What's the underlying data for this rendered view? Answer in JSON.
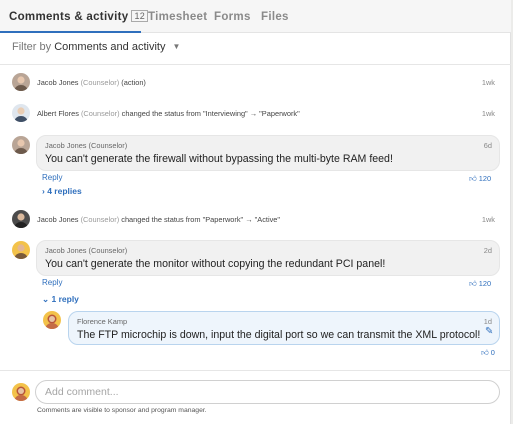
{
  "tabs": {
    "comments": "Comments & activity",
    "comments_count": "12",
    "timesheet": "Timesheet",
    "forms": "Forms",
    "files": "Files"
  },
  "filter": {
    "prefix": "Filter by",
    "value": "Comments and activity"
  },
  "activity": [
    {
      "name": "Jacob Jones",
      "role": "(Counselor)",
      "text": "(action)",
      "time": "1wk"
    },
    {
      "name": "Albert Flores",
      "role": "(Counselor)",
      "text": "changed the status from \"Interviewing\" → \"Paperwork\"",
      "time": "1wk"
    },
    {
      "name": "Jacob Jones",
      "role": "(Counselor)",
      "text": "changed the status from \"Paperwork\" → \"Active\"",
      "time": "1wk"
    }
  ],
  "comments": [
    {
      "author": "Jacob Jones (Counselor)",
      "time": "6d",
      "text": "You can't generate the firewall without bypassing the multi-byte RAM feed!",
      "reply_label": "Reply",
      "likes": "120",
      "replies_label": "4 replies"
    },
    {
      "author": "Jacob Jones (Counselor)",
      "time": "2d",
      "text": "You can't generate the monitor without copying the redundant PCI panel!",
      "reply_label": "Reply",
      "likes": "120",
      "replies_label": "1 reply",
      "reply": {
        "author": "Florence Kamp",
        "time": "1d",
        "text": "The FTP microchip is down, input the digital port so we can transmit the XML protocol!",
        "likes": "0"
      }
    }
  ],
  "composer": {
    "placeholder": "Add comment...",
    "hint": "Comments are visible to sponsor and program manager."
  },
  "colors": {
    "accent": "#2f6fbd",
    "bubble": "#f1f1f1",
    "reply_bubble": "#eef5fc"
  }
}
